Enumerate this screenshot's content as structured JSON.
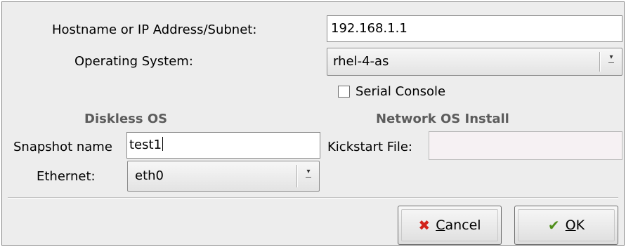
{
  "host": {
    "label": "Hostname or IP Address/Subnet:",
    "value": "192.168.1.1"
  },
  "os": {
    "label": "Operating System:",
    "selected": "rhel-4-as"
  },
  "serial_console": {
    "label": "Serial Console",
    "checked": false
  },
  "diskless": {
    "title": "Diskless OS",
    "snapshot_label": "Snapshot name",
    "snapshot_value": "test1",
    "ethernet_label": "Ethernet:",
    "ethernet_selected": "eth0"
  },
  "network": {
    "title": "Network OS Install",
    "kickstart_label": "Kickstart File:",
    "kickstart_value": ""
  },
  "buttons": {
    "cancel_mnemonic": "C",
    "cancel_rest": "ancel",
    "ok_mnemonic": "O",
    "ok_rest": "K"
  },
  "icons": {
    "cancel": "x-icon",
    "ok": "checkmark-icon"
  },
  "colors": {
    "cancel_icon": "#d2231b",
    "ok_icon": "#4f8e1a"
  }
}
